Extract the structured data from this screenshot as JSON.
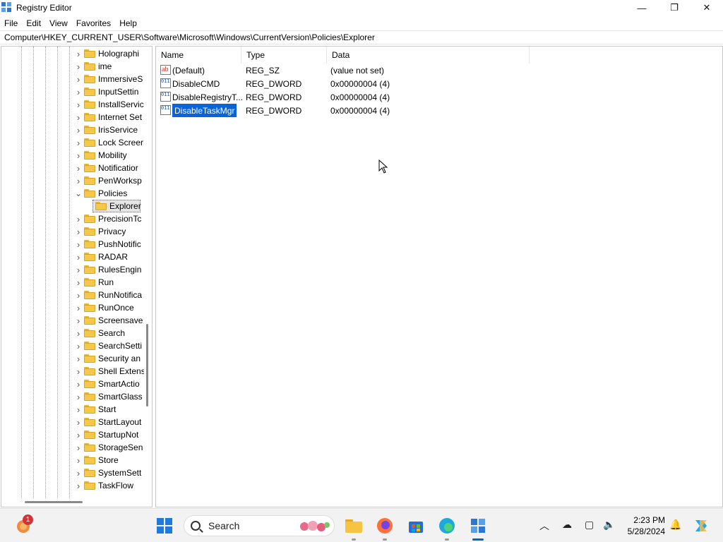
{
  "window": {
    "title": "Registry Editor",
    "controls": {
      "minimize": "—",
      "maximize": "❐",
      "close": "✕"
    }
  },
  "menu": [
    "File",
    "Edit",
    "View",
    "Favorites",
    "Help"
  ],
  "address": "Computer\\HKEY_CURRENT_USER\\Software\\Microsoft\\Windows\\CurrentVersion\\Policies\\Explorer",
  "tree": {
    "items": [
      "Holographi",
      "ime",
      "ImmersiveS",
      "InputSettin",
      "InstallServic",
      "Internet Set",
      "IrisService",
      "Lock Screer",
      "Mobility",
      "Notificatior",
      "PenWorksp",
      "Policies",
      "Explorer",
      "PrecisionTc",
      "Privacy",
      "PushNotific",
      "RADAR",
      "RulesEngin",
      "Run",
      "RunNotifica",
      "RunOnce",
      "Screensave",
      "Search",
      "SearchSetti",
      "Security an",
      "Shell Extens",
      "SmartActio",
      "SmartGlass",
      "Start",
      "StartLayout",
      "StartupNot",
      "StorageSen",
      "Store",
      "SystemSett",
      "TaskFlow"
    ],
    "selected": "Explorer",
    "expanded": "Policies"
  },
  "list": {
    "columns": [
      "Name",
      "Type",
      "Data"
    ],
    "rows": [
      {
        "name": "(Default)",
        "type": "REG_SZ",
        "data": "(value not set)",
        "icon": "string-value-icon"
      },
      {
        "name": "DisableCMD",
        "type": "REG_DWORD",
        "data": "0x00000004 (4)",
        "icon": "dword-value-icon"
      },
      {
        "name": "DisableRegistryT...",
        "type": "REG_DWORD",
        "data": "0x00000004 (4)",
        "icon": "dword-value-icon"
      },
      {
        "name": "DisableTaskMgr",
        "type": "REG_DWORD",
        "data": "0x00000004 (4)",
        "icon": "dword-value-icon"
      }
    ],
    "selected": "DisableTaskMgr"
  },
  "taskbar": {
    "search_placeholder": "Search",
    "notification_count": "1",
    "time": "2:23 PM",
    "date": "5/28/2024"
  },
  "colors": {
    "selection": "#0a64d8",
    "folder": "#f5c84a",
    "accent": "#0067c0"
  }
}
